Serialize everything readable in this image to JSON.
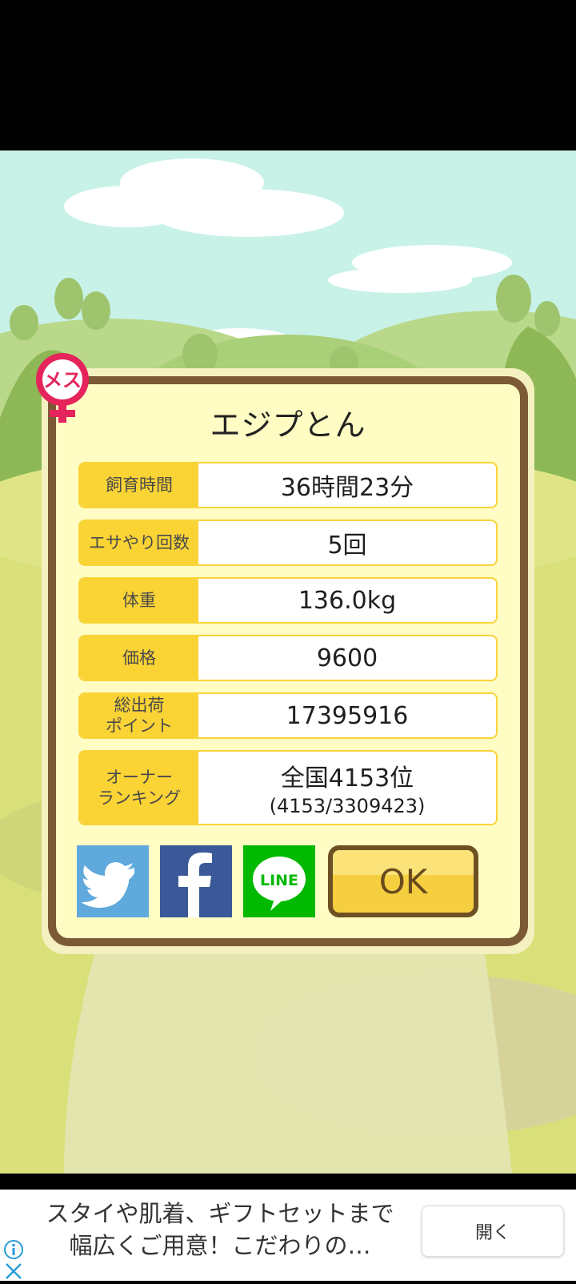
{
  "pig": {
    "name": "エジプとん",
    "gender_badge": "メス"
  },
  "stats": [
    {
      "label": "飼育時間",
      "value": "36時間23分"
    },
    {
      "label": "エサやり回数",
      "value": "5回"
    },
    {
      "label": "体重",
      "value": "136.0kg"
    },
    {
      "label": "価格",
      "value": "9600"
    },
    {
      "label_lines": [
        "総出荷",
        "ポイント"
      ],
      "value": "17395916"
    },
    {
      "label_lines": [
        "オーナー",
        "ランキング"
      ],
      "value": "全国4153位",
      "sub": "(4153/3309423)"
    }
  ],
  "share": {
    "line_label": "LINE"
  },
  "ok_label": "OK",
  "ad": {
    "text_line1": "スタイや肌着、ギフトセットまで",
    "text_line2": "幅広くご用意！こだわりの…",
    "open_label": "開く"
  },
  "colors": {
    "sky": "#c8f2e8",
    "dialog_border": "#7b5a35",
    "dialog_fill": "#fffcc4",
    "label_fill": "#fad335",
    "twitter": "#5fa9dd",
    "facebook": "#3b5998",
    "line": "#00b900",
    "badge": "#e5245b"
  },
  "icons": [
    "female-symbol-icon",
    "twitter-bird-icon",
    "facebook-f-icon",
    "line-logo-icon",
    "info-icon",
    "close-icon"
  ]
}
